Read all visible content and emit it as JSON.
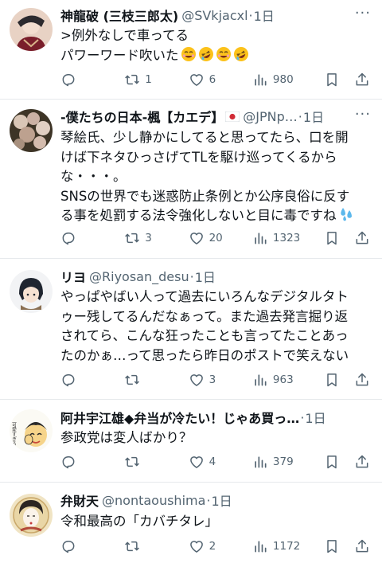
{
  "tweets": [
    {
      "name": "神龍破 (三枝三郎太)",
      "handle": "@SVkjacxl",
      "time": "1日",
      "lines": [
        ">例外なしで車ってる",
        "パワーワード吹いた"
      ],
      "replies": "",
      "retweets": "1",
      "likes": "6",
      "views": "980"
    },
    {
      "name": "-僕たちの日本-楓【カエデ】",
      "handle": "@JPNp…",
      "time": "1日",
      "lines": [
        "琴絵氏、少し静かにしてると思ってたら、口を開",
        "けば下ネタひっさげてTLを駆け巡ってくるから",
        "な・・・。",
        "SNSの世界でも迷惑防止条例とか公序良俗に反す",
        "る事を処罰する法令強化しないと目に毒ですね"
      ],
      "replies": "",
      "retweets": "3",
      "likes": "20",
      "views": "1323"
    },
    {
      "name": "リヨ",
      "handle": "@Riyosan_desu",
      "time": "1日",
      "lines": [
        "やっぱやばい人って過去にいろんなデジタルタト",
        "ゥー残してるんだなぁって。また過去発言掘り返",
        "されてら、こんな狂ったことも言ってたことあっ",
        "たのかぁ…って思ったら昨日のポストで笑えない"
      ],
      "replies": "",
      "retweets": "",
      "likes": "3",
      "views": "963"
    },
    {
      "name": "阿井宇江雄◆弁当が冷たい！じゃあ買っ…",
      "handle": "",
      "time": "1日",
      "lines": [
        "参政党は変人ばかり？"
      ],
      "replies": "",
      "retweets": "",
      "likes": "4",
      "views": "379"
    },
    {
      "name": "弁財天",
      "handle": "@nontaoushima",
      "time": "1日",
      "lines": [
        "令和最高の「カバチタレ」"
      ],
      "replies": "",
      "retweets": "",
      "likes": "2",
      "views": "1172"
    }
  ],
  "more_label": "···",
  "dot": "·",
  "avatar_caption": "可愛すぎる",
  "icons": {
    "reply": "reply-icon",
    "retweet": "retweet-icon",
    "like": "heart-icon",
    "views": "views-icon",
    "bookmark": "bookmark-icon",
    "share": "share-icon"
  },
  "colors": {
    "text": "#0f1419",
    "muted": "#536471",
    "divider": "#e6e9ec"
  }
}
